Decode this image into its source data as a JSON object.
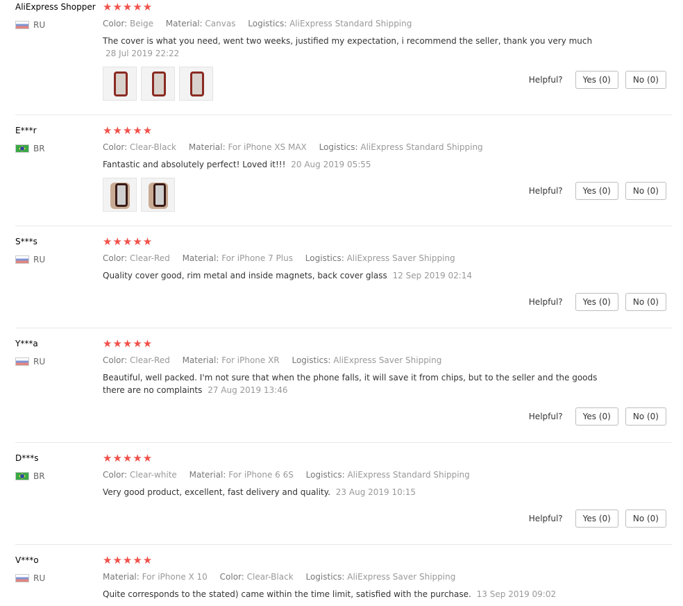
{
  "labels": {
    "color": "Color:",
    "material": "Material:",
    "logistics": "Logistics:",
    "helpful": "Helpful?"
  },
  "stars_glyph": "★★★★★",
  "reviews": [
    {
      "user": "AliExpress Shopper",
      "country": "RU",
      "flag": "ru",
      "rating": 5,
      "color": "Beige",
      "material": "Canvas",
      "logistics": "AliExpress Standard Shipping",
      "text": "The cover is what you need, went two weeks, justified my expectation, i recommend the seller, thank you very much",
      "date": "28 Jul 2019 22:22",
      "photos": 3,
      "yes": "Yes (0)",
      "no": "No (0)"
    },
    {
      "user": "E***r",
      "country": "BR",
      "flag": "br",
      "rating": 5,
      "color": "Clear-Black",
      "material": "For iPhone XS MAX",
      "logistics": "AliExpress Standard Shipping",
      "text": "Fantastic and absolutely perfect! Loved it!!!",
      "date": "20 Aug 2019 05:55",
      "photos": 2,
      "yes": "Yes (0)",
      "no": "No (0)"
    },
    {
      "user": "S***s",
      "country": "RU",
      "flag": "ru",
      "rating": 5,
      "color": "Clear-Red",
      "material": "For iPhone 7 Plus",
      "logistics": "AliExpress Saver Shipping",
      "text": "Quality cover good, rim metal and inside magnets, back cover glass",
      "date": "12 Sep 2019 02:14",
      "photos": 0,
      "yes": "Yes (0)",
      "no": "No (0)"
    },
    {
      "user": "Y***a",
      "country": "RU",
      "flag": "ru",
      "rating": 5,
      "color": "Clear-Red",
      "material": "For iPhone XR",
      "logistics": "AliExpress Saver Shipping",
      "text": "Beautiful, well packed. I'm not sure that when the phone falls, it will save it from chips, but to the seller and the goods there are no complaints",
      "date": "27 Aug 2019 13:46",
      "photos": 0,
      "yes": "Yes (0)",
      "no": "No (0)"
    },
    {
      "user": "D***s",
      "country": "BR",
      "flag": "br",
      "rating": 5,
      "color": "Clear-white",
      "material": "For iPhone 6 6S",
      "logistics": "AliExpress Standard Shipping",
      "text": "Very good product, excellent, fast delivery and quality.",
      "date": "23 Aug 2019 10:15",
      "photos": 0,
      "yes": "Yes (0)",
      "no": "No (0)"
    },
    {
      "user": "V***o",
      "country": "RU",
      "flag": "ru",
      "rating": 5,
      "material": "For iPhone X 10",
      "color": "Clear-Black",
      "logistics": "AliExpress Saver Shipping",
      "text": "Quite corresponds to the stated) came within the time limit, satisfied with the purchase.",
      "date": "13 Sep 2019 09:02",
      "photos": 0
    }
  ]
}
